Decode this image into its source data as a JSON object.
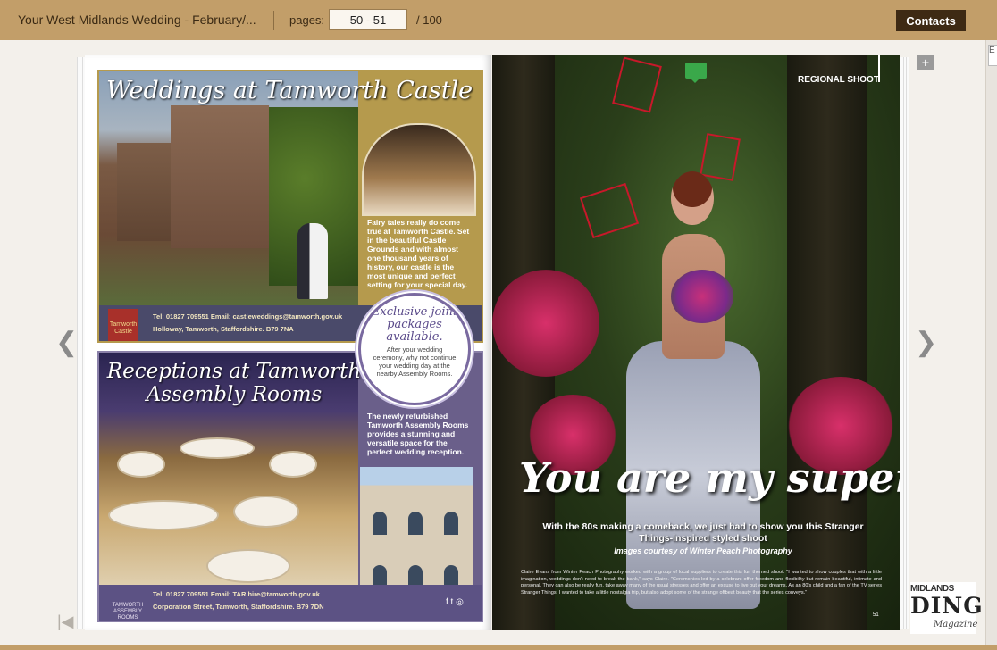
{
  "topbar": {
    "title": "Your West Midlands Wedding - February/...",
    "pages_label": "pages:",
    "pages_value": "50 - 51",
    "total": "/  100",
    "contacts_label": "Contacts"
  },
  "edge_box": "E",
  "nav": {
    "prev": "❮",
    "next": "❯",
    "first": "|◀"
  },
  "sticky_add": "+",
  "left_page": {
    "castle": {
      "title": "Weddings at Tamworth Castle",
      "text": "Fairy tales really do come true at Tamworth Castle. Set in the beautiful Castle Grounds and with almost one thousand years of history, our castle is the most unique and perfect setting for your special day.",
      "contact_line1": "Tel: 01827 709551    Email: castleweddings@tamworth.gov.uk",
      "contact_line2": "Holloway, Tamworth, Staffordshire. B79 7NA",
      "crest_label": "Tamworth Castle"
    },
    "badge": {
      "title": "Exclusive joint packages available.",
      "text": "After your wedding ceremony, why not continue your wedding day at the nearby Assembly Rooms."
    },
    "assembly": {
      "title": "Receptions at Tamworth Assembly Rooms",
      "text": "The newly refurbished Tamworth Assembly Rooms provides a stunning and versatile space for the perfect wedding reception.",
      "contact_line1": "Tel: 01827 709551    Email: TAR.hire@tamworth.gov.uk",
      "contact_line2": "Corporation Street, Tamworth, Staffordshire. B79 7DN",
      "logo_label": "TAMWORTH ASSEMBLY ROOMS",
      "social": "f  t  ◎"
    }
  },
  "right_page": {
    "section_label": "REGIONAL SHOOT",
    "headline": "You are my superhero",
    "subhead": "With the 80s making a comeback, we just had to show you this Stranger Things-inspired styled shoot",
    "credit": "Images courtesy of Winter Peach Photography",
    "body": "Claire Evans from Winter Peach Photography worked with a group of local suppliers to create this fun themed shoot. \"I wanted to show couples that with a little imagination, weddings don't need to break the bank,\" says Claire. \"Ceremonies led by a celebrant offer freedom and flexibility but remain beautiful, intimate and personal. They can also be really fun, take away many of the usual stresses and offer an excuse to live out your dreams. As an 80's child and a fan of the TV series Stranger Things, I wanted to take a little nostalgia trip, but also adopt some of the strange offbeat beauty that the series conveys.\"",
    "page_number": "51"
  },
  "logo": {
    "top": "MIDLANDS",
    "mid": "DING",
    "bottom": "Magazine"
  }
}
